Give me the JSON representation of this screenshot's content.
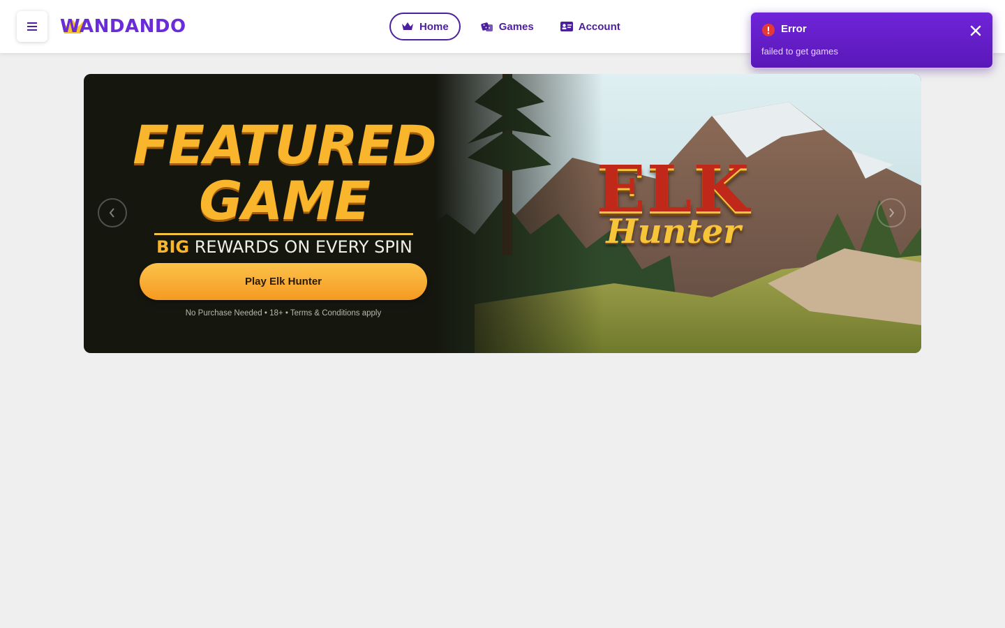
{
  "header": {
    "logo_text": "WANDANDO",
    "nav": [
      {
        "label": "Home",
        "icon": "crown-icon",
        "active": true
      },
      {
        "label": "Games",
        "icon": "dice-icon",
        "active": false
      },
      {
        "label": "Account",
        "icon": "id-card-icon",
        "active": false
      }
    ]
  },
  "toast": {
    "title": "Error",
    "message": "failed to get games"
  },
  "banner": {
    "title_line1": "FEATURED",
    "title_line2": "GAME",
    "subline_big": "BIG",
    "subline_rest": "REWARDS ON EVERY SPIN",
    "play_label": "Play Elk Hunter",
    "disclaimer": "No Purchase Needed • 18+ •  Terms & Conditions apply",
    "game_logo_line1": "ELK",
    "game_logo_line2": "Hunter"
  },
  "colors": {
    "brand": "#4b1f9e",
    "toast_bg": "#6f24d8",
    "accent": "#f9b52b",
    "page_bg": "#efefef"
  }
}
